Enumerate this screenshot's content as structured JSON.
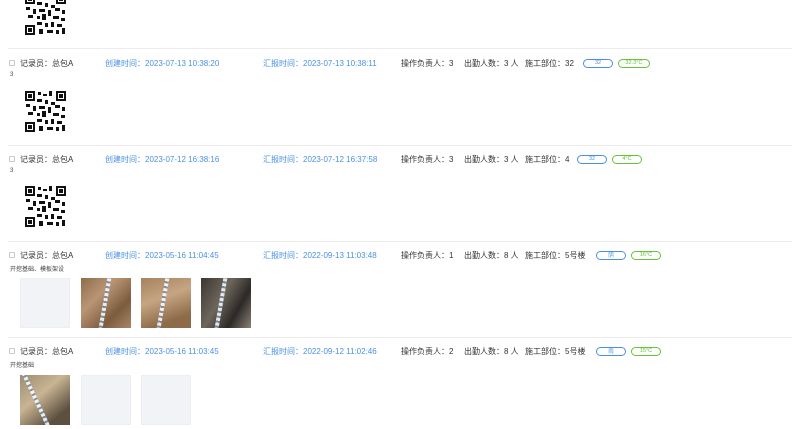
{
  "records": [
    {
      "recorder": "记录员：总包A",
      "created": "创建时间：2023-07-13 10:38:20",
      "reported": "汇报时间：2023-07-13 10:38:11",
      "operator": "操作负责人：3",
      "attendance": "出勤人数：3 人",
      "location": "施工部位：32",
      "badge1": "32",
      "badge2": "32.3°C",
      "note": "3"
    },
    {
      "recorder": "记录员：总包A",
      "created": "创建时间：2023-07-12 16:38:16",
      "reported": "汇报时间：2023-07-12 16:37:58",
      "operator": "操作负责人：3",
      "attendance": "出勤人数：3 人",
      "location": "施工部位：4",
      "badge1": "32",
      "badge2": "4°C",
      "note": "3"
    },
    {
      "recorder": "记录员：总包A",
      "created": "创建时间：2023-05-16 11:04:45",
      "reported": "汇报时间：2022-09-13 11:03:48",
      "operator": "操作负责人：1",
      "attendance": "出勤人数：8 人",
      "location": "施工部位：5号楼",
      "badge1": "阴",
      "badge2": "16°C",
      "note": "开挖基础、模板架设"
    },
    {
      "recorder": "记录员：总包A",
      "created": "创建时间：2023-05-16 11:03:45",
      "reported": "汇报时间：2022-09-12 11:02:46",
      "operator": "操作负责人：2",
      "attendance": "出勤人数：8 人",
      "location": "施工部位：5号楼",
      "badge1": "雨",
      "badge2": "15°C",
      "note": "开挖基础"
    }
  ],
  "colors": {
    "link_blue": "#4a90e2",
    "temp_green": "#67c23a",
    "divider": "#ececec"
  }
}
